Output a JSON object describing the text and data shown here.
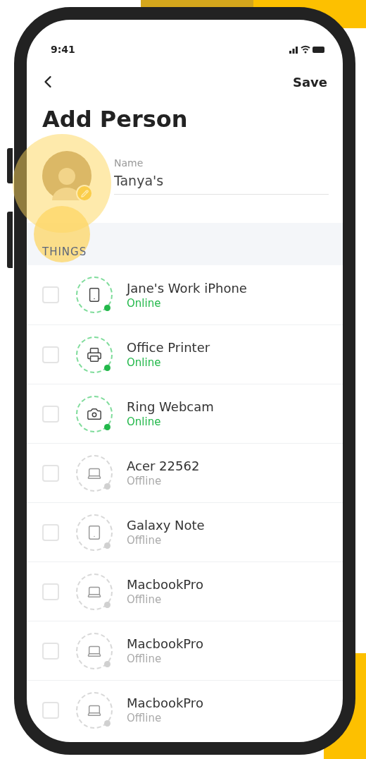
{
  "status_bar": {
    "time": "9:41"
  },
  "header": {
    "action": "Save",
    "title": "Add Person"
  },
  "person": {
    "name_label": "Name",
    "name_value": "Tanya's"
  },
  "section": {
    "title": "THINGS"
  },
  "devices": [
    {
      "name": "Jane's Work iPhone",
      "status": "Online",
      "online": true,
      "kind": "phone",
      "checked": false
    },
    {
      "name": "Office Printer",
      "status": "Online",
      "online": true,
      "kind": "printer",
      "checked": false
    },
    {
      "name": "Ring Webcam",
      "status": "Online",
      "online": true,
      "kind": "camera",
      "checked": false
    },
    {
      "name": "Acer 22562",
      "status": "Offline",
      "online": false,
      "kind": "laptop",
      "checked": false
    },
    {
      "name": "Galaxy Note",
      "status": "Offline",
      "online": false,
      "kind": "tablet",
      "checked": false
    },
    {
      "name": "MacbookPro",
      "status": "Offline",
      "online": false,
      "kind": "laptop",
      "checked": false
    },
    {
      "name": "MacbookPro",
      "status": "Offline",
      "online": false,
      "kind": "laptop",
      "checked": false
    },
    {
      "name": "MacbookPro",
      "status": "Offline",
      "online": false,
      "kind": "laptop",
      "checked": false
    }
  ]
}
